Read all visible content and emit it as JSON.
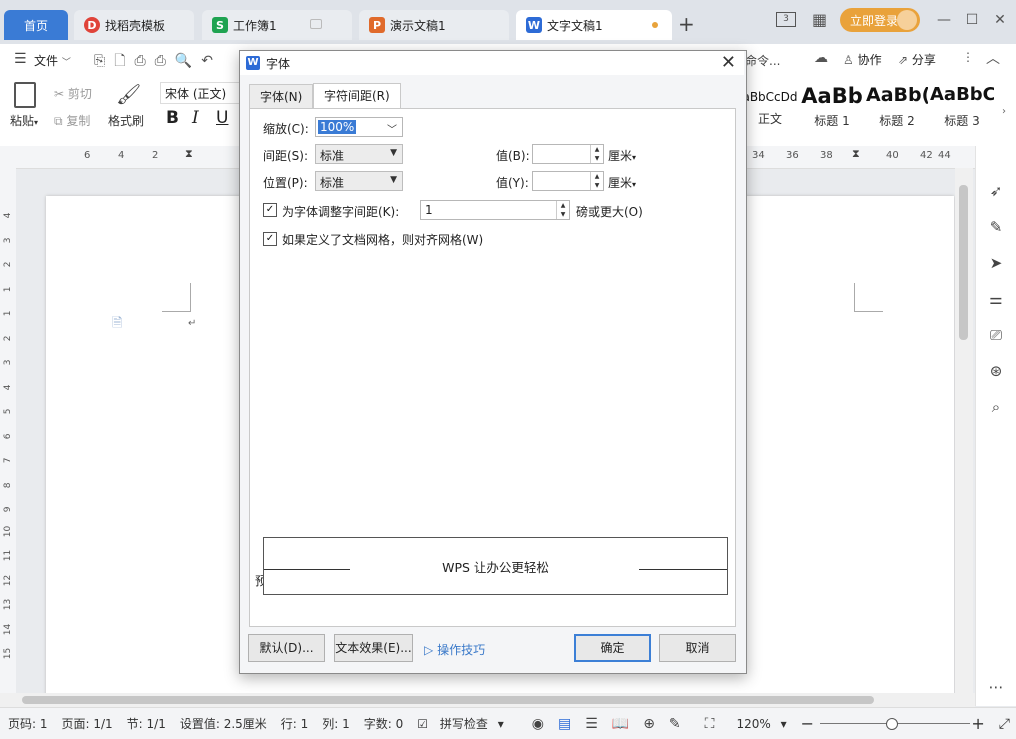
{
  "tabs": {
    "home": "首页",
    "templates": "找稻壳模板",
    "workbook": "工作簿1",
    "slides": "演示文稿1",
    "document": "文字文稿1",
    "login": "立即登录"
  },
  "menubar": {
    "file": "文件",
    "collab": "协作",
    "share": "分享",
    "truncated": "命令..."
  },
  "ribbon": {
    "paste": "粘贴",
    "cut": "剪切",
    "copy": "复制",
    "format_painter": "格式刷",
    "font_name": "宋体 (正文)",
    "bold": "B",
    "italic": "I",
    "underline": "U",
    "styles": [
      {
        "sample": "aBbCcDd",
        "name": "正文"
      },
      {
        "sample": "AaBb",
        "name": "标题 1"
      },
      {
        "sample": "AaBb(",
        "name": "标题 2"
      },
      {
        "sample": "AaBbC",
        "name": "标题 3"
      }
    ]
  },
  "ruler": {
    "ticks_left": [
      "6",
      "4",
      "2"
    ],
    "ticks_right": [
      "34",
      "36",
      "38",
      "40",
      "42",
      "44"
    ],
    "vticks": [
      "4",
      "3",
      "2",
      "1",
      "1",
      "2",
      "3",
      "4",
      "5",
      "6",
      "7",
      "8",
      "9",
      "10",
      "11",
      "12",
      "13",
      "14",
      "15"
    ]
  },
  "dialog": {
    "title": "字体",
    "tab_font": "字体(N)",
    "tab_spacing": "字符间距(R)",
    "scale_label": "缩放(C):",
    "scale_value": "100%",
    "spacing_label": "间距(S):",
    "spacing_value": "标准",
    "spacing_by_label": "值(B):",
    "spacing_unit": "厘米",
    "position_label": "位置(P):",
    "position_value": "标准",
    "position_by_label": "值(Y):",
    "position_unit": "厘米",
    "kerning_label": "为字体调整字间距(K):",
    "kerning_value": "1",
    "kerning_suffix": "磅或更大(O)",
    "grid_label": "如果定义了文档网格，则对齐网格(W)",
    "preview_label": "预览",
    "preview_text": "WPS 让办公更轻松",
    "default_btn": "默认(D)...",
    "text_effects_btn": "文本效果(E)...",
    "tips_link": "操作技巧",
    "ok_btn": "确定",
    "cancel_btn": "取消"
  },
  "status": {
    "page_num": "页码: 1",
    "pages": "页面: 1/1",
    "section": "节: 1/1",
    "setting": "设置值: 2.5厘米",
    "row": "行: 1",
    "col": "列: 1",
    "words": "字数: 0",
    "spell": "拼写检查",
    "zoom": "120%"
  },
  "colors": {
    "accent": "#3a7bd5",
    "login": "#e9a23b",
    "link": "#3a79c9"
  }
}
